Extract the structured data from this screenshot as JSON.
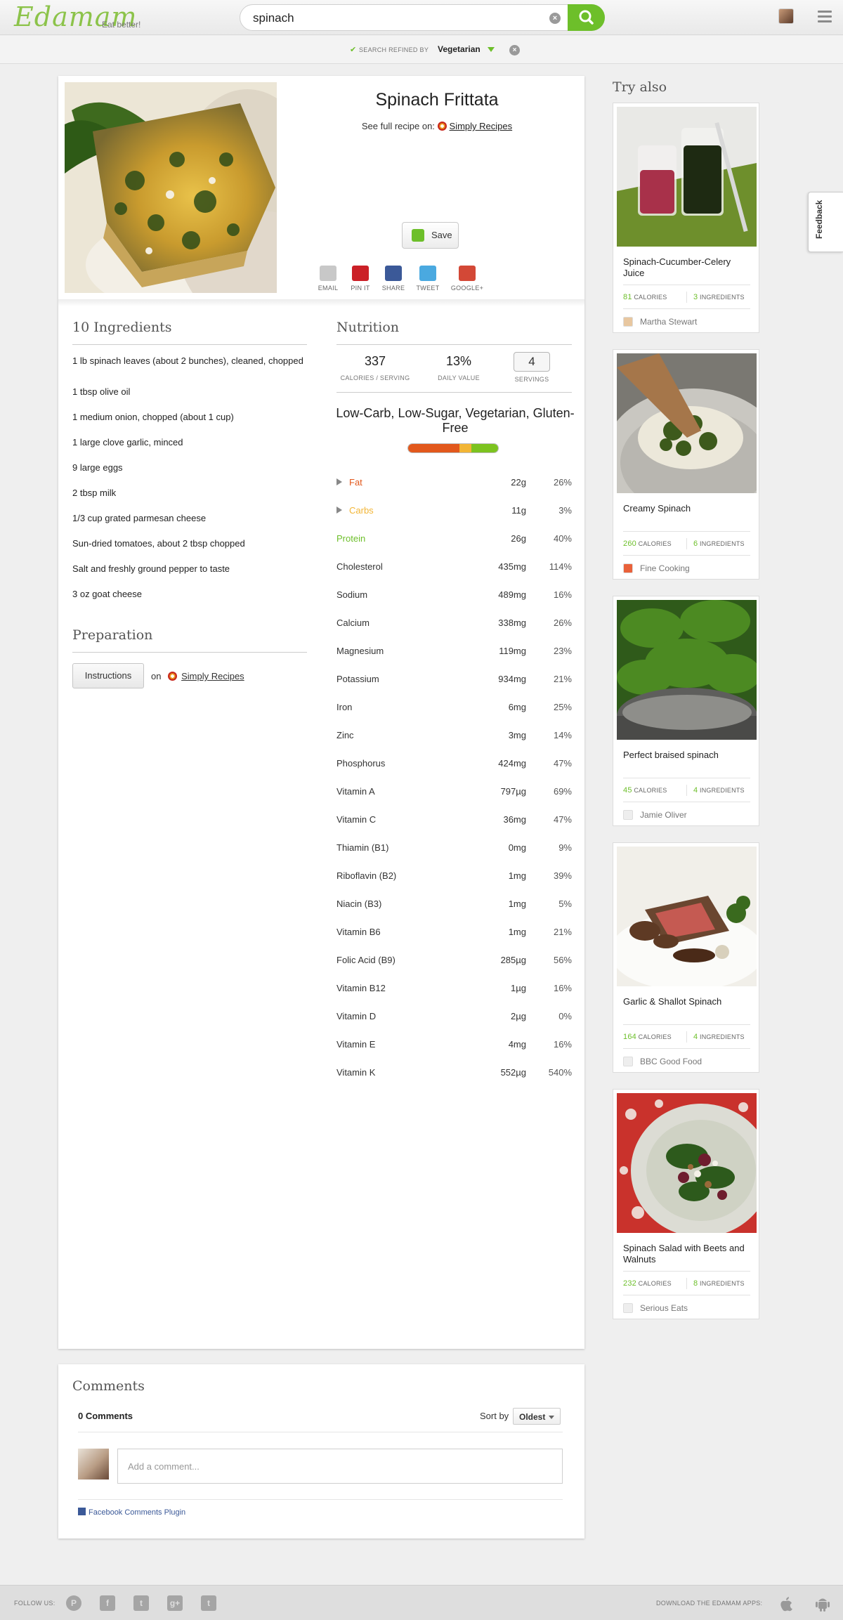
{
  "header": {
    "logo": "Edamam",
    "tagline": "Eat better!",
    "search_value": "spinach",
    "clear_icon": "close-circle-icon",
    "search_icon": "magnifier-icon",
    "menu_icon": "hamburger-icon"
  },
  "refine": {
    "label": "SEARCH REFINED BY",
    "value": "Vegetarian"
  },
  "recipe": {
    "title": "Spinach Frittata",
    "full_recipe_prefix": "See full recipe on:",
    "source": "Simply Recipes",
    "save_label": "Save",
    "share": [
      {
        "label": "EMAIL",
        "icon": "email-icon",
        "color": "#c8c8c8"
      },
      {
        "label": "PIN IT",
        "icon": "pinterest-icon",
        "color": "#cb2027"
      },
      {
        "label": "SHARE",
        "icon": "facebook-icon",
        "color": "#3b5998"
      },
      {
        "label": "TWEET",
        "icon": "twitter-icon",
        "color": "#4aa9e0"
      },
      {
        "label": "GOOGLE+",
        "icon": "google-plus-icon",
        "color": "#d34836"
      }
    ]
  },
  "ingredients": {
    "heading": "10 Ingredients",
    "items": [
      "1 lb spinach leaves (about 2 bunches), cleaned, chopped",
      "1 tbsp olive oil",
      "1 medium onion, chopped (about 1 cup)",
      "1 large clove garlic, minced",
      "9 large eggs",
      "2 tbsp milk",
      "1/3 cup grated parmesan cheese",
      "Sun-dried tomatoes, about 2 tbsp chopped",
      "Salt and freshly ground pepper to taste",
      "3 oz goat cheese"
    ]
  },
  "preparation": {
    "heading": "Preparation",
    "button": "Instructions",
    "on": "on",
    "source": "Simply Recipes"
  },
  "nutrition": {
    "heading": "Nutrition",
    "calories": "337",
    "calories_label": "CALORIES / SERVING",
    "daily_value": "13%",
    "daily_label": "DAILY VALUE",
    "servings": "4",
    "servings_label": "SERVINGS",
    "labels": "Low-Carb, Low-Sugar, Vegetarian, Gluten-Free",
    "bar": [
      {
        "name": "fat",
        "fraction": 0.57,
        "color": "#e2581c"
      },
      {
        "name": "carbs",
        "fraction": 0.13,
        "color": "#f2b535"
      },
      {
        "name": "protein",
        "fraction": 0.3,
        "color": "#7cc31f"
      }
    ],
    "rows": [
      {
        "name": "Fat",
        "qty": "22g",
        "pct": "26%",
        "color": "#e2581c",
        "expand": true
      },
      {
        "name": "Carbs",
        "qty": "11g",
        "pct": "3%",
        "color": "#f2b535",
        "expand": true
      },
      {
        "name": "Protein",
        "qty": "26g",
        "pct": "40%",
        "color": "#6dbf2a",
        "expand": false
      },
      {
        "name": "Cholesterol",
        "qty": "435mg",
        "pct": "114%"
      },
      {
        "name": "Sodium",
        "qty": "489mg",
        "pct": "16%"
      },
      {
        "name": "Calcium",
        "qty": "338mg",
        "pct": "26%"
      },
      {
        "name": "Magnesium",
        "qty": "119mg",
        "pct": "23%"
      },
      {
        "name": "Potassium",
        "qty": "934mg",
        "pct": "21%"
      },
      {
        "name": "Iron",
        "qty": "6mg",
        "pct": "25%"
      },
      {
        "name": "Zinc",
        "qty": "3mg",
        "pct": "14%"
      },
      {
        "name": "Phosphorus",
        "qty": "424mg",
        "pct": "47%"
      },
      {
        "name": "Vitamin A",
        "qty": "797µg",
        "pct": "69%"
      },
      {
        "name": "Vitamin C",
        "qty": "36mg",
        "pct": "47%"
      },
      {
        "name": "Thiamin (B1)",
        "qty": "0mg",
        "pct": "9%"
      },
      {
        "name": "Riboflavin (B2)",
        "qty": "1mg",
        "pct": "39%"
      },
      {
        "name": "Niacin (B3)",
        "qty": "1mg",
        "pct": "5%"
      },
      {
        "name": "Vitamin B6",
        "qty": "1mg",
        "pct": "21%"
      },
      {
        "name": "Folic Acid (B9)",
        "qty": "285µg",
        "pct": "56%"
      },
      {
        "name": "Vitamin B12",
        "qty": "1µg",
        "pct": "16%"
      },
      {
        "name": "Vitamin D",
        "qty": "2µg",
        "pct": "0%"
      },
      {
        "name": "Vitamin E",
        "qty": "4mg",
        "pct": "16%"
      },
      {
        "name": "Vitamin K",
        "qty": "552µg",
        "pct": "540%"
      }
    ]
  },
  "try_also": {
    "heading": "Try also",
    "calories_label": "CALORIES",
    "ingredients_label": "INGREDIENTS",
    "items": [
      {
        "title": "Spinach-Cucumber-Celery Juice",
        "calories": "81",
        "ingredients": "3",
        "source": "Martha Stewart"
      },
      {
        "title": "Creamy Spinach",
        "calories": "260",
        "ingredients": "6",
        "source": "Fine Cooking"
      },
      {
        "title": "Perfect braised spinach",
        "calories": "45",
        "ingredients": "4",
        "source": "Jamie Oliver"
      },
      {
        "title": "Garlic & Shallot Spinach",
        "calories": "164",
        "ingredients": "4",
        "source": "BBC Good Food"
      },
      {
        "title": "Spinach Salad with Beets and Walnuts",
        "calories": "232",
        "ingredients": "8",
        "source": "Serious Eats"
      }
    ]
  },
  "feedback": "Feedback",
  "comments": {
    "heading": "Comments",
    "count": "0 Comments",
    "sort_by": "Sort by",
    "sort_value": "Oldest",
    "placeholder": "Add a comment...",
    "plugin": "Facebook Comments Plugin"
  },
  "footer": {
    "follow": "FOLLOW US:",
    "download": "DOWNLOAD THE EDAMAM APPS:",
    "social": [
      {
        "icon": "pinterest-icon",
        "glyph": "P"
      },
      {
        "icon": "facebook-icon",
        "glyph": "f"
      },
      {
        "icon": "twitter-icon",
        "glyph": "t"
      },
      {
        "icon": "google-plus-icon",
        "glyph": "g+"
      },
      {
        "icon": "tumblr-icon",
        "glyph": "t"
      }
    ]
  }
}
